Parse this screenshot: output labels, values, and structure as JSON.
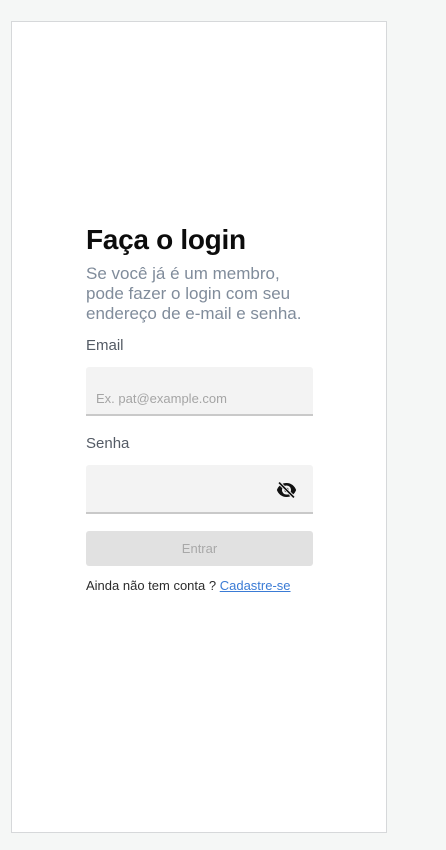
{
  "login": {
    "title": "Faça o login",
    "subtitle": "Se você já é um membro, pode fazer o login com seu endereço de e-mail e senha.",
    "email_label": "Email",
    "email_placeholder": "Ex. pat@example.com",
    "email_value": "",
    "password_label": "Senha",
    "password_value": "",
    "password_toggle_icon": "eye-off-icon",
    "submit_label": "Entrar",
    "submit_enabled": false,
    "signup_prompt": "Ainda não tem conta ?",
    "signup_link": "Cadastre-se"
  },
  "colors": {
    "page_bg": "#f5f7f6",
    "card_bg": "#ffffff",
    "title": "#0c0c0c",
    "subtitle": "#808c9b",
    "input_bg": "#f3f3f3",
    "button_disabled_bg": "#e1e1e1",
    "link": "#3a7bd5"
  }
}
